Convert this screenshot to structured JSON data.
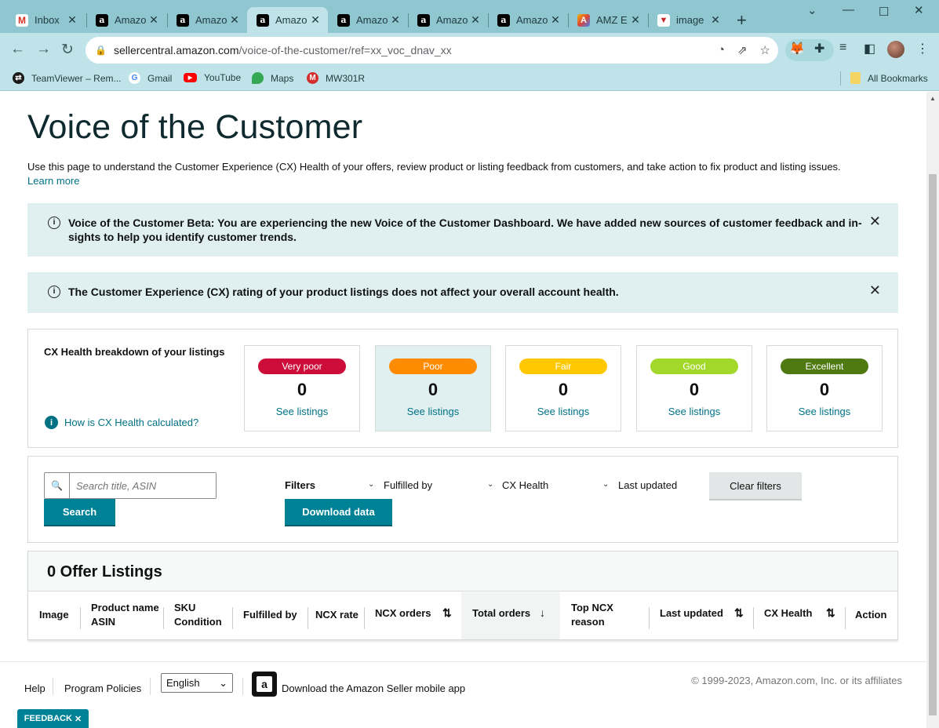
{
  "browser": {
    "tabs": [
      {
        "label": "Inbox",
        "icon": "gmail-icon"
      },
      {
        "label": "Amazo",
        "icon": "amazon-icon"
      },
      {
        "label": "Amazo",
        "icon": "amazon-icon"
      },
      {
        "label": "Amazo",
        "icon": "amazon-icon"
      },
      {
        "label": "Amazo",
        "icon": "amazon-icon"
      },
      {
        "label": "Amazo",
        "icon": "amazon-icon"
      },
      {
        "label": "Amazo",
        "icon": "amazon-icon"
      },
      {
        "label": "AMZ E",
        "icon": "amz-extension-icon"
      },
      {
        "label": "image",
        "icon": "image-tab-icon"
      }
    ],
    "url_host": "sellercentral.amazon.com",
    "url_path": "/voice-of-the-customer/ref=xx_voc_dnav_xx",
    "bookmarks": [
      {
        "label": "TeamViewer – Rem...",
        "color": "#1a1a1a"
      },
      {
        "label": "Gmail",
        "color": "#ffffff"
      },
      {
        "label": "YouTube",
        "color": "#ff0000"
      },
      {
        "label": "Maps",
        "color": "#34a853"
      },
      {
        "label": "MW301R",
        "color": "#d32f2f"
      }
    ],
    "all_bookmarks": "All Bookmarks"
  },
  "page": {
    "title": "Voice of the Customer",
    "intro": "Use this page to understand the Customer Experience (CX) Health of your offers, review product or listing feedback from customers, and take action to fix product and listing issues.",
    "learn_more": "Learn more",
    "alerts": [
      {
        "text": "Voice of the Customer Beta: You are experiencing the new Voice of the Customer Dashboard. We have added new sources of customer feedback and in-sights to help you identify customer trends."
      },
      {
        "text": "The Customer Experience (CX) rating of your product listings does not affect your overall account health."
      }
    ],
    "cx": {
      "title": "CX Health breakdown of your listings",
      "how": "How is CX Health calculated?",
      "cards": [
        {
          "label": "Very poor",
          "count": "0",
          "link": "See listings",
          "color": "#cc0c39"
        },
        {
          "label": "Poor",
          "count": "0",
          "link": "See listings",
          "color": "#ff8c00"
        },
        {
          "label": "Fair",
          "count": "0",
          "link": "See listings",
          "color": "#ffc800"
        },
        {
          "label": "Good",
          "count": "0",
          "link": "See listings",
          "color": "#a2d82a"
        },
        {
          "label": "Excellent",
          "count": "0",
          "link": "See listings",
          "color": "#4f7a11"
        }
      ]
    },
    "filters": {
      "search_placeholder": "Search title, ASIN",
      "search_button": "Search",
      "filters_label": "Filters",
      "fulfilled_by": "Fulfilled by",
      "cx_health": "CX Health",
      "last_updated": "Last updated",
      "clear": "Clear filters",
      "download": "Download data"
    },
    "listings": {
      "count_label": "0 Offer Listings",
      "columns": {
        "image": "Image",
        "product_name": "Product name",
        "asin": "ASIN",
        "sku": "SKU",
        "condition": "Condition",
        "fulfilled_by": "Fulfilled by",
        "ncx_rate": "NCX rate",
        "ncx_orders": "NCX orders",
        "total_orders": "Total orders",
        "top_ncx": "Top NCX",
        "reason": "reason",
        "last_updated": "Last updated",
        "cx_health": "CX Health",
        "action": "Action"
      }
    },
    "footer": {
      "help": "Help",
      "policies": "Program Policies",
      "language": "English",
      "app": "Download the Amazon Seller mobile app",
      "copyright": "© 1999-2023, Amazon.com, Inc. or its affiliates"
    },
    "feedback": "FEEDBACK"
  }
}
